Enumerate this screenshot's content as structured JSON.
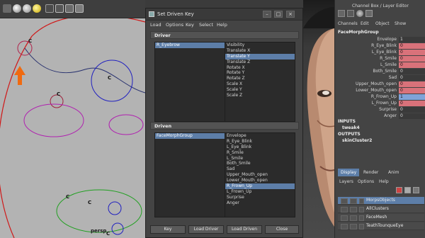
{
  "dialog": {
    "title": "Set Driven Key",
    "menu": [
      "Load",
      "Options",
      "Key",
      "Select",
      "Help"
    ],
    "driver_header": "Driver",
    "driven_header": "Driven",
    "driver_objects": [
      "R_Eyebrow"
    ],
    "driver_attributes": [
      "Visibility",
      "Translate X",
      "Translate Y",
      "Translate Z",
      "Rotate X",
      "Rotate Y",
      "Rotate Z",
      "Scale X",
      "Scale Y",
      "Scale Z"
    ],
    "driver_attr_selected": "Translate Y",
    "driven_objects": [
      "FaceMorphGroup"
    ],
    "driven_attributes": [
      "Envelope",
      "R_Eye_Blink",
      "L_Eye_Blink",
      "R_Smile",
      "L_Smile",
      "Both_Smile",
      "Sad",
      "Upper_Mouth_open",
      "Lower_Mouth_open",
      "R_Frown_Up",
      "L_Frown_Up",
      "Surprise",
      "Anger"
    ],
    "driven_attr_selected": "R_Frown_Up",
    "buttons": {
      "key": "Key",
      "load_driver": "Load Driver",
      "load_driven": "Load Driven",
      "close": "Close"
    }
  },
  "viewport": {
    "persp_label": "persp",
    "curve_labels": [
      "C",
      "C",
      "C",
      "C",
      "C",
      "C"
    ]
  },
  "channel_box": {
    "title": "Channel Box / Layer Editor",
    "menu": [
      "Channels",
      "Edit",
      "Object",
      "Show"
    ],
    "object_name": "FaceMorphGroup",
    "attributes": [
      {
        "name": "Envelope",
        "value": "1",
        "state": "plain"
      },
      {
        "name": "R_Eye_Blink",
        "value": "0",
        "state": "keyed"
      },
      {
        "name": "L_Eye_Blink",
        "value": "0",
        "state": "keyed"
      },
      {
        "name": "R_Smile",
        "value": "0",
        "state": "keyed"
      },
      {
        "name": "L_Smile",
        "value": "0",
        "state": "keyed"
      },
      {
        "name": "Both_Smile",
        "value": "0",
        "state": "plain"
      },
      {
        "name": "Sad",
        "value": "0",
        "state": "plain"
      },
      {
        "name": "Upper_Mouth_open",
        "value": "0",
        "state": "keyed"
      },
      {
        "name": "Lower_Mouth_open",
        "value": "0",
        "state": "keyed"
      },
      {
        "name": "R_Frown_Up",
        "value": "1",
        "state": "selected"
      },
      {
        "name": "L_Frown_Up",
        "value": "0",
        "state": "keyed"
      },
      {
        "name": "Surprise",
        "value": "0",
        "state": "plain"
      },
      {
        "name": "Anger",
        "value": "0",
        "state": "plain"
      }
    ],
    "inputs_label": "INPUTS",
    "inputs": [
      "tweak4"
    ],
    "outputs_label": "OUTPUTS",
    "outputs": [
      "skinCluster2"
    ]
  },
  "layer_editor": {
    "tabs": [
      "Display",
      "Render",
      "Anim"
    ],
    "menu": [
      "Layers",
      "Options",
      "Help"
    ],
    "layers": [
      "MorpsObjects",
      "AllClusters",
      "FaceMesh",
      "TeathTounqueEye"
    ]
  },
  "colors": {
    "keyed": "#d9727a",
    "selected": "#7fa3d8",
    "plain": "#3a3a3a",
    "selection": "#5d7ea8",
    "arrow": "#f06a10"
  }
}
